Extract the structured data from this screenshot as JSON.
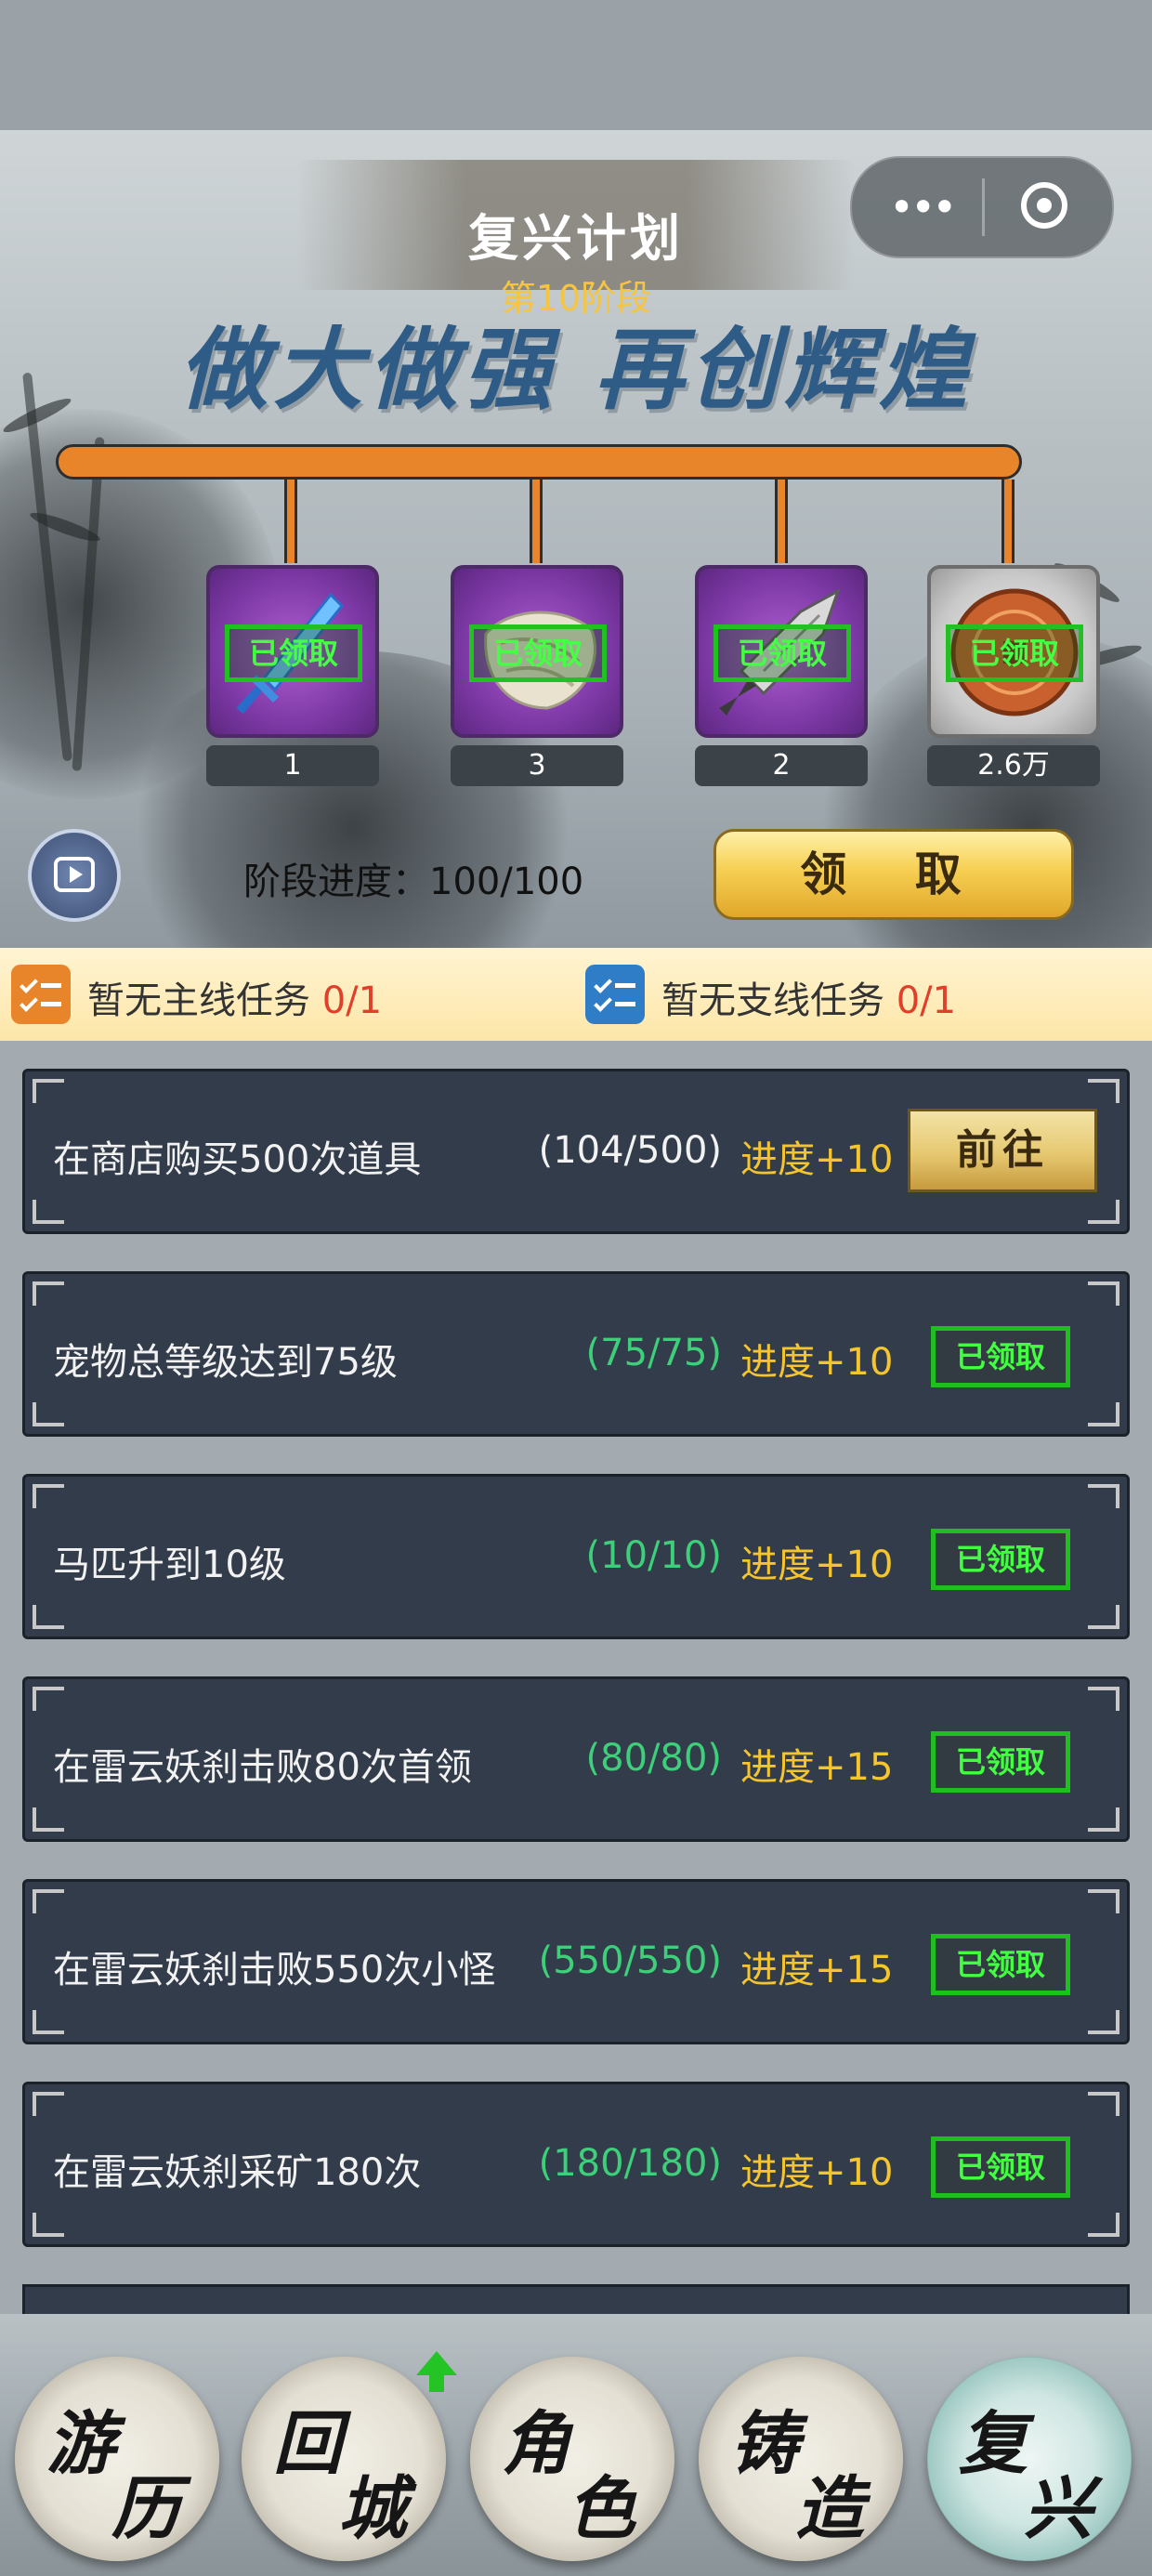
{
  "header": {
    "title": "复兴计划",
    "stage": "第10阶段",
    "menu_icon": "more-dots-icon",
    "close_icon": "target-close-icon"
  },
  "slogan": "做大做强  再创辉煌",
  "rewards": [
    {
      "icon": "sword-icon",
      "count": "1",
      "status": "已领取"
    },
    {
      "icon": "cloth-bundle-icon",
      "count": "3",
      "status": "已领取"
    },
    {
      "icon": "dagger-icon",
      "count": "2",
      "status": "已领取"
    },
    {
      "icon": "coin-icon",
      "count": "2.6万",
      "status": "已领取"
    }
  ],
  "progress": {
    "label": "阶段进度：100/100",
    "value": 100,
    "max": 100
  },
  "claim_button": "领 取",
  "task_tabs": [
    {
      "label": "暂无主线任务 ",
      "count": "0/1",
      "color": "#e8852a"
    },
    {
      "label": "暂无支线任务 ",
      "count": "0/1",
      "color": "#2f7cc7"
    }
  ],
  "tasks": [
    {
      "name": "在商店购买500次道具",
      "progress": "(104/500)",
      "gain": "进度+10",
      "action": "前往",
      "done": false
    },
    {
      "name": "宠物总等级达到75级",
      "progress": "(75/75)",
      "gain": "进度+10",
      "action": "已领取",
      "done": true
    },
    {
      "name": "马匹升到10级",
      "progress": "(10/10)",
      "gain": "进度+10",
      "action": "已领取",
      "done": true
    },
    {
      "name": "在雷云妖刹击败80次首领",
      "progress": "(80/80)",
      "gain": "进度+15",
      "action": "已领取",
      "done": true
    },
    {
      "name": "在雷云妖刹击败550次小怪",
      "progress": "(550/550)",
      "gain": "进度+15",
      "action": "已领取",
      "done": true
    },
    {
      "name": "在雷云妖刹采矿180次",
      "progress": "(180/180)",
      "gain": "进度+10",
      "action": "已领取",
      "done": true
    }
  ],
  "colors": {
    "progress_incomplete": "#f2f2f2",
    "progress_complete": "#3ecf7a",
    "gain": "#f5c530",
    "claimed_green": "#42ff42"
  },
  "nav": [
    {
      "c1": "游",
      "c2": "历",
      "active": false
    },
    {
      "c1": "回",
      "c2": "城",
      "active": false,
      "badge": "up-arrow-icon"
    },
    {
      "c1": "角",
      "c2": "色",
      "active": false
    },
    {
      "c1": "铸",
      "c2": "造",
      "active": false
    },
    {
      "c1": "复",
      "c2": "兴",
      "active": true
    }
  ]
}
